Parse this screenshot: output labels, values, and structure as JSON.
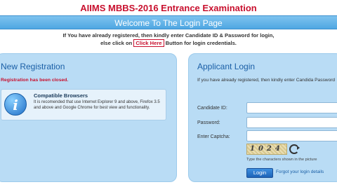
{
  "header": {
    "title": "AIIMS MBBS-2016 Entrance Examination",
    "welcome": "Welcome To The Login Page"
  },
  "instructions": {
    "line1": "If You have already registered, then kindly enter Candidate ID & Password for login,",
    "line2_before": "else click on",
    "click_here": "Click Here",
    "line2_after": "Button for login credentials."
  },
  "new_registration": {
    "title": "New Registration",
    "closed_message": "Registration has been closed.",
    "compatible": {
      "icon": "info-icon",
      "title": "Compatible Browsers",
      "text": "It is recomended that use Internet Explorer 9 and above, Firefox 3.5 and above and Google Chrome for best view and functionality."
    }
  },
  "applicant_login": {
    "title": "Applicant Login",
    "instructions": "If you have already registered, then kindly enter Candida Password",
    "candidate_id_label": "Candidate ID:",
    "candidate_id_value": "",
    "password_label": "Password:",
    "password_value": "",
    "captcha_label": "Enter Captcha:",
    "captcha_value": "",
    "captcha_image_text": "1024",
    "captcha_hint": "Type the characters shown in the picture",
    "login_button": "Login",
    "forgot_link": "Forgot your login details"
  },
  "colors": {
    "title_red": "#c8102e",
    "banner_blue": "#4fa7e2",
    "panel_blue": "#b9dcf5",
    "button_blue": "#1d63b8"
  }
}
